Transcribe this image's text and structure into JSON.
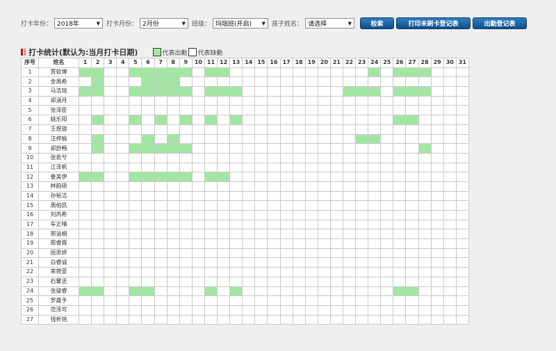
{
  "filters": {
    "year_label": "打卡年份：",
    "year_value": "2018年",
    "month_label": "打卡月份：",
    "month_value": "2月份",
    "class_label": "班级：",
    "class_value": "玛瑙班(开启)",
    "child_label": "孩子姓名：",
    "child_value": "请选择"
  },
  "buttons": {
    "search": "检索",
    "print_unswiped": "打印未刷卡登记表",
    "attendance_register": "出勤登记表"
  },
  "section": {
    "title": "打卡统计(默认为:当月打卡日期)",
    "legend_present": "代表出勤",
    "legend_absent": "代表缺勤"
  },
  "colors": {
    "present": "#a3e6a3",
    "absent": "#ffffff",
    "button": "#1a5f9e",
    "title_marker": "#b4141c"
  },
  "table": {
    "header_index": "序号",
    "header_name": "姓名",
    "days": [
      "1",
      "2",
      "3",
      "4",
      "5",
      "6",
      "7",
      "8",
      "9",
      "10",
      "11",
      "12",
      "13",
      "14",
      "15",
      "16",
      "17",
      "18",
      "19",
      "20",
      "21",
      "22",
      "23",
      "24",
      "25",
      "26",
      "27",
      "28",
      "29",
      "30",
      "31"
    ],
    "rows": [
      {
        "no": "1",
        "name": "贾软博",
        "present": [
          1,
          2,
          5,
          6,
          7,
          8,
          9,
          11,
          12,
          24,
          26,
          27,
          28
        ]
      },
      {
        "no": "2",
        "name": "金周希",
        "present": [
          2,
          6,
          7,
          8
        ]
      },
      {
        "no": "3",
        "name": "马浩铭",
        "present": [
          1,
          2,
          5,
          6,
          7,
          8,
          9,
          11,
          12,
          13,
          22,
          23,
          24,
          26,
          27,
          28
        ]
      },
      {
        "no": "4",
        "name": "郑涵月",
        "present": []
      },
      {
        "no": "5",
        "name": "张泽臣",
        "present": []
      },
      {
        "no": "6",
        "name": "姚乐阳",
        "present": [
          2,
          5,
          7,
          9,
          11,
          13,
          26,
          27
        ]
      },
      {
        "no": "7",
        "name": "王煜骁",
        "present": []
      },
      {
        "no": "8",
        "name": "汪梓瑜",
        "present": [
          2,
          6,
          8,
          23,
          24
        ]
      },
      {
        "no": "9",
        "name": "郑舒畅",
        "present": [
          2,
          5,
          6,
          7,
          8,
          9,
          28
        ]
      },
      {
        "no": "10",
        "name": "张若兮",
        "present": []
      },
      {
        "no": "11",
        "name": "江泽帆",
        "present": []
      },
      {
        "no": "12",
        "name": "姜美伊",
        "present": [
          1,
          2,
          5,
          6,
          7,
          8,
          9,
          11,
          12
        ]
      },
      {
        "no": "13",
        "name": "林韵硕",
        "present": []
      },
      {
        "no": "14",
        "name": "孙裕洁",
        "present": []
      },
      {
        "no": "15",
        "name": "周柏凯",
        "present": []
      },
      {
        "no": "16",
        "name": "刘芮希",
        "present": []
      },
      {
        "no": "17",
        "name": "车正晴",
        "present": []
      },
      {
        "no": "18",
        "name": "邢语桐",
        "present": []
      },
      {
        "no": "19",
        "name": "邢睿霖",
        "present": []
      },
      {
        "no": "20",
        "name": "屈思妍",
        "present": []
      },
      {
        "no": "21",
        "name": "白睿诚",
        "present": []
      },
      {
        "no": "22",
        "name": "荣菀萱",
        "present": []
      },
      {
        "no": "23",
        "name": "石馨丞",
        "present": []
      },
      {
        "no": "24",
        "name": "张骏睿",
        "present": [
          1,
          2,
          5,
          6,
          11,
          13,
          26,
          27
        ]
      },
      {
        "no": "25",
        "name": "罗晨予",
        "present": []
      },
      {
        "no": "26",
        "name": "范泽可",
        "present": []
      },
      {
        "no": "27",
        "name": "钱析铭",
        "present": []
      }
    ]
  }
}
